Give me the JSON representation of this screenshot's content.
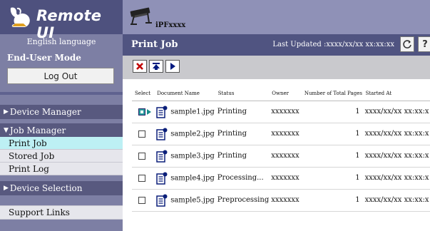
{
  "app": {
    "logo_text": "Remote UI",
    "language_link": "English language",
    "mode_label": "End-User Mode",
    "logout_label": "Log Out"
  },
  "nav": {
    "device_manager": "Device Manager",
    "job_manager": "Job Manager",
    "print_job": "Print Job",
    "stored_job": "Stored Job",
    "print_log": "Print Log",
    "device_selection": "Device Selection",
    "support_links": "Support Links"
  },
  "header": {
    "printer_name": "iPFxxxx"
  },
  "title_bar": {
    "title": "Print Job",
    "last_updated": "Last Updated :xxxx/xx/xx xx:xx:xx",
    "help_label": "?"
  },
  "table": {
    "columns": [
      "Select",
      "Document Name",
      "Status",
      "Owner",
      "Number of Total Pages",
      "Started At"
    ],
    "rows": [
      {
        "document": "sample1.jpg",
        "status": "Printing",
        "owner": "xxxxxxx",
        "pages": "1",
        "started": "xxxx/xx/xx xx:xx:x",
        "checked": true
      },
      {
        "document": "sample2.jpg",
        "status": "Printing",
        "owner": "xxxxxxx",
        "pages": "1",
        "started": "xxxx/xx/xx xx:xx:x",
        "checked": false
      },
      {
        "document": "sample3.jpg",
        "status": "Printing",
        "owner": "xxxxxxx",
        "pages": "1",
        "started": "xxxx/xx/xx xx:xx:x",
        "checked": false
      },
      {
        "document": "sample4.jpg",
        "status": "Processing...",
        "owner": "xxxxxxx",
        "pages": "1",
        "started": "xxxx/xx/xx xx:xx:x",
        "checked": false
      },
      {
        "document": "sample5.jpg",
        "status": "Preprocessing",
        "owner": "xxxxxxx",
        "pages": "1",
        "started": "xxxx/xx/xx xx:xx:x",
        "checked": false
      }
    ]
  },
  "icons": {
    "cancel": "cancel-x-icon",
    "move_top": "move-to-top-icon",
    "resume": "play-icon",
    "refresh": "refresh-icon",
    "document": "document-icon",
    "printer": "printer-icon",
    "logo": "rabbit-logo-icon"
  },
  "colors": {
    "sidebar": "#7d7fa4",
    "title_bar": "#505481",
    "active_nav": "#bdf0f4",
    "header": "#8f91b7"
  }
}
